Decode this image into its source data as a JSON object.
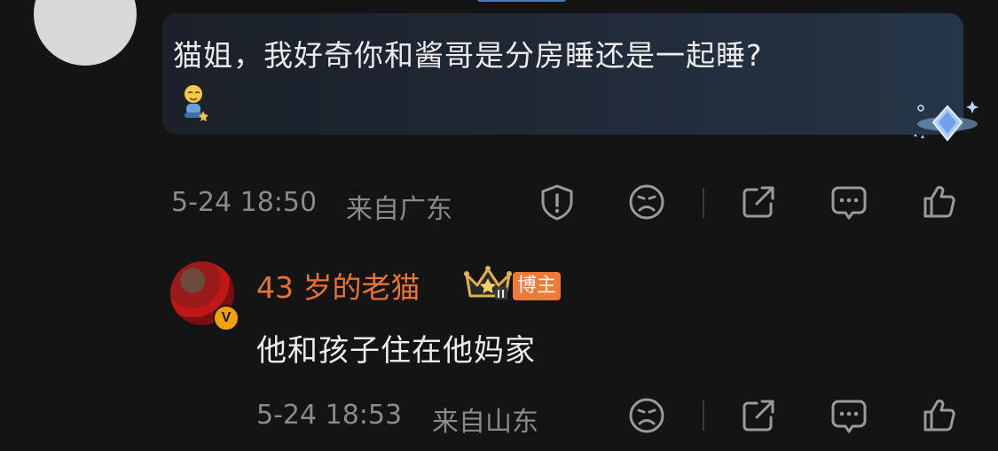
{
  "top_comment": {
    "text": "猫姐，我好奇你和酱哥是分房睡还是一起睡?",
    "timestamp": "5-24 18:50",
    "location": "来自广东",
    "actions": [
      "report-icon",
      "dislike-icon",
      "share-icon",
      "comment-icon",
      "like-icon"
    ]
  },
  "reply": {
    "author_name": "43 岁的老猫",
    "author_badge": "博主",
    "verified_badge": "V",
    "text": "他和孩子住在他妈家",
    "timestamp": "5-24 18:53",
    "location": "来自山东",
    "actions": [
      "dislike-icon",
      "share-icon",
      "comment-icon",
      "like-icon"
    ]
  },
  "colors": {
    "background": "#141414",
    "bubble": "#1f2733",
    "author_name": "#e8742e",
    "badge": "#ee7a3a",
    "meta": "#8a8a8a"
  }
}
